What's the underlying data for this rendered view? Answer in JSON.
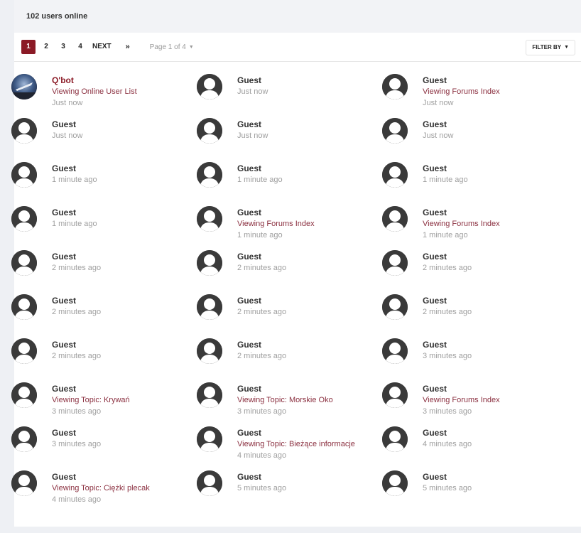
{
  "header": {
    "title": "102 users online"
  },
  "pagination": {
    "pages": [
      "1",
      "2",
      "3",
      "4"
    ],
    "next_label": "NEXT",
    "last_label": "»",
    "page_info": "Page 1 of 4"
  },
  "filter": {
    "label": "FILTER BY"
  },
  "colors": {
    "accent": "#8b1a26",
    "activity": "#8b3040"
  },
  "users": [
    {
      "name": "Q'bot",
      "activity": "Viewing Online User List",
      "time": "Just now",
      "avatar": "bot-avatar"
    },
    {
      "name": "Guest",
      "activity": "",
      "time": "Just now"
    },
    {
      "name": "Guest",
      "activity": "Viewing Forums Index",
      "time": "Just now"
    },
    {
      "name": "Guest",
      "activity": "",
      "time": "Just now"
    },
    {
      "name": "Guest",
      "activity": "",
      "time": "Just now"
    },
    {
      "name": "Guest",
      "activity": "",
      "time": "Just now"
    },
    {
      "name": "Guest",
      "activity": "",
      "time": "1 minute ago"
    },
    {
      "name": "Guest",
      "activity": "",
      "time": "1 minute ago"
    },
    {
      "name": "Guest",
      "activity": "",
      "time": "1 minute ago"
    },
    {
      "name": "Guest",
      "activity": "",
      "time": "1 minute ago"
    },
    {
      "name": "Guest",
      "activity": "Viewing Forums Index",
      "time": "1 minute ago"
    },
    {
      "name": "Guest",
      "activity": "Viewing Forums Index",
      "time": "1 minute ago"
    },
    {
      "name": "Guest",
      "activity": "",
      "time": "2 minutes ago"
    },
    {
      "name": "Guest",
      "activity": "",
      "time": "2 minutes ago"
    },
    {
      "name": "Guest",
      "activity": "",
      "time": "2 minutes ago"
    },
    {
      "name": "Guest",
      "activity": "",
      "time": "2 minutes ago"
    },
    {
      "name": "Guest",
      "activity": "",
      "time": "2 minutes ago"
    },
    {
      "name": "Guest",
      "activity": "",
      "time": "2 minutes ago"
    },
    {
      "name": "Guest",
      "activity": "",
      "time": "2 minutes ago"
    },
    {
      "name": "Guest",
      "activity": "",
      "time": "2 minutes ago"
    },
    {
      "name": "Guest",
      "activity": "",
      "time": "3 minutes ago"
    },
    {
      "name": "Guest",
      "activity": "Viewing Topic: Krywań",
      "time": "3 minutes ago"
    },
    {
      "name": "Guest",
      "activity": "Viewing Topic: Morskie Oko",
      "time": "3 minutes ago"
    },
    {
      "name": "Guest",
      "activity": "Viewing Forums Index",
      "time": "3 minutes ago"
    },
    {
      "name": "Guest",
      "activity": "",
      "time": "3 minutes ago"
    },
    {
      "name": "Guest",
      "activity": "Viewing Topic: Bieżące informacje",
      "time": "4 minutes ago"
    },
    {
      "name": "Guest",
      "activity": "",
      "time": "4 minutes ago"
    },
    {
      "name": "Guest",
      "activity": "Viewing Topic: Ciężki plecak",
      "time": "4 minutes ago"
    },
    {
      "name": "Guest",
      "activity": "",
      "time": "5 minutes ago"
    },
    {
      "name": "Guest",
      "activity": "",
      "time": "5 minutes ago"
    }
  ]
}
